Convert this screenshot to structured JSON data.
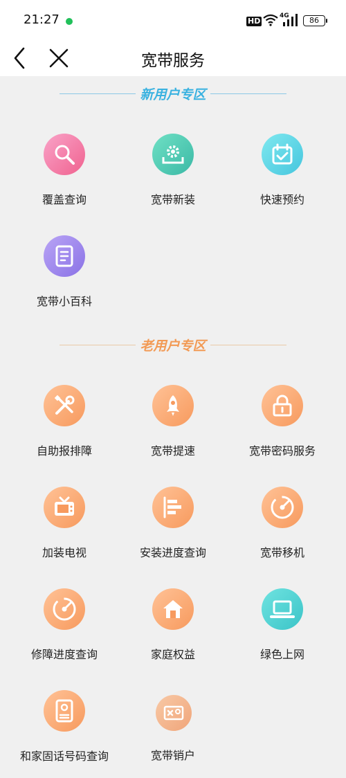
{
  "status": {
    "time": "21:27",
    "hd": "HD",
    "network": "4G",
    "battery": "86"
  },
  "nav": {
    "title": "宽带服务"
  },
  "sections": {
    "new_users": {
      "title": "新用户专区"
    },
    "old_users": {
      "title": "老用户专区"
    }
  },
  "new_tiles": [
    {
      "label": "覆盖查询",
      "icon": "search-icon"
    },
    {
      "label": "宽带新装",
      "icon": "gear-install-icon"
    },
    {
      "label": "快速预约",
      "icon": "calendar-check-icon"
    },
    {
      "label": "宽带小百科",
      "icon": "book-icon"
    }
  ],
  "old_tiles": [
    {
      "label": "自助报排障",
      "icon": "tools-icon"
    },
    {
      "label": "宽带提速",
      "icon": "rocket-icon"
    },
    {
      "label": "宽带密码服务",
      "icon": "lock-icon"
    },
    {
      "label": "加装电视",
      "icon": "tv-icon"
    },
    {
      "label": "安装进度查询",
      "icon": "progress-bars-icon"
    },
    {
      "label": "宽带移机",
      "icon": "gauge-icon"
    },
    {
      "label": "修障进度查询",
      "icon": "gauge-icon"
    },
    {
      "label": "家庭权益",
      "icon": "home-icon"
    },
    {
      "label": "绿色上网",
      "icon": "laptop-icon"
    },
    {
      "label": "和家固话号码查询",
      "icon": "id-card-icon"
    },
    {
      "label": "宽带销户",
      "icon": "cancel-card-icon"
    }
  ],
  "colors": {
    "new_accent": "#3ab2e0",
    "old_accent": "#f29a55",
    "background": "#f0f0f0"
  }
}
